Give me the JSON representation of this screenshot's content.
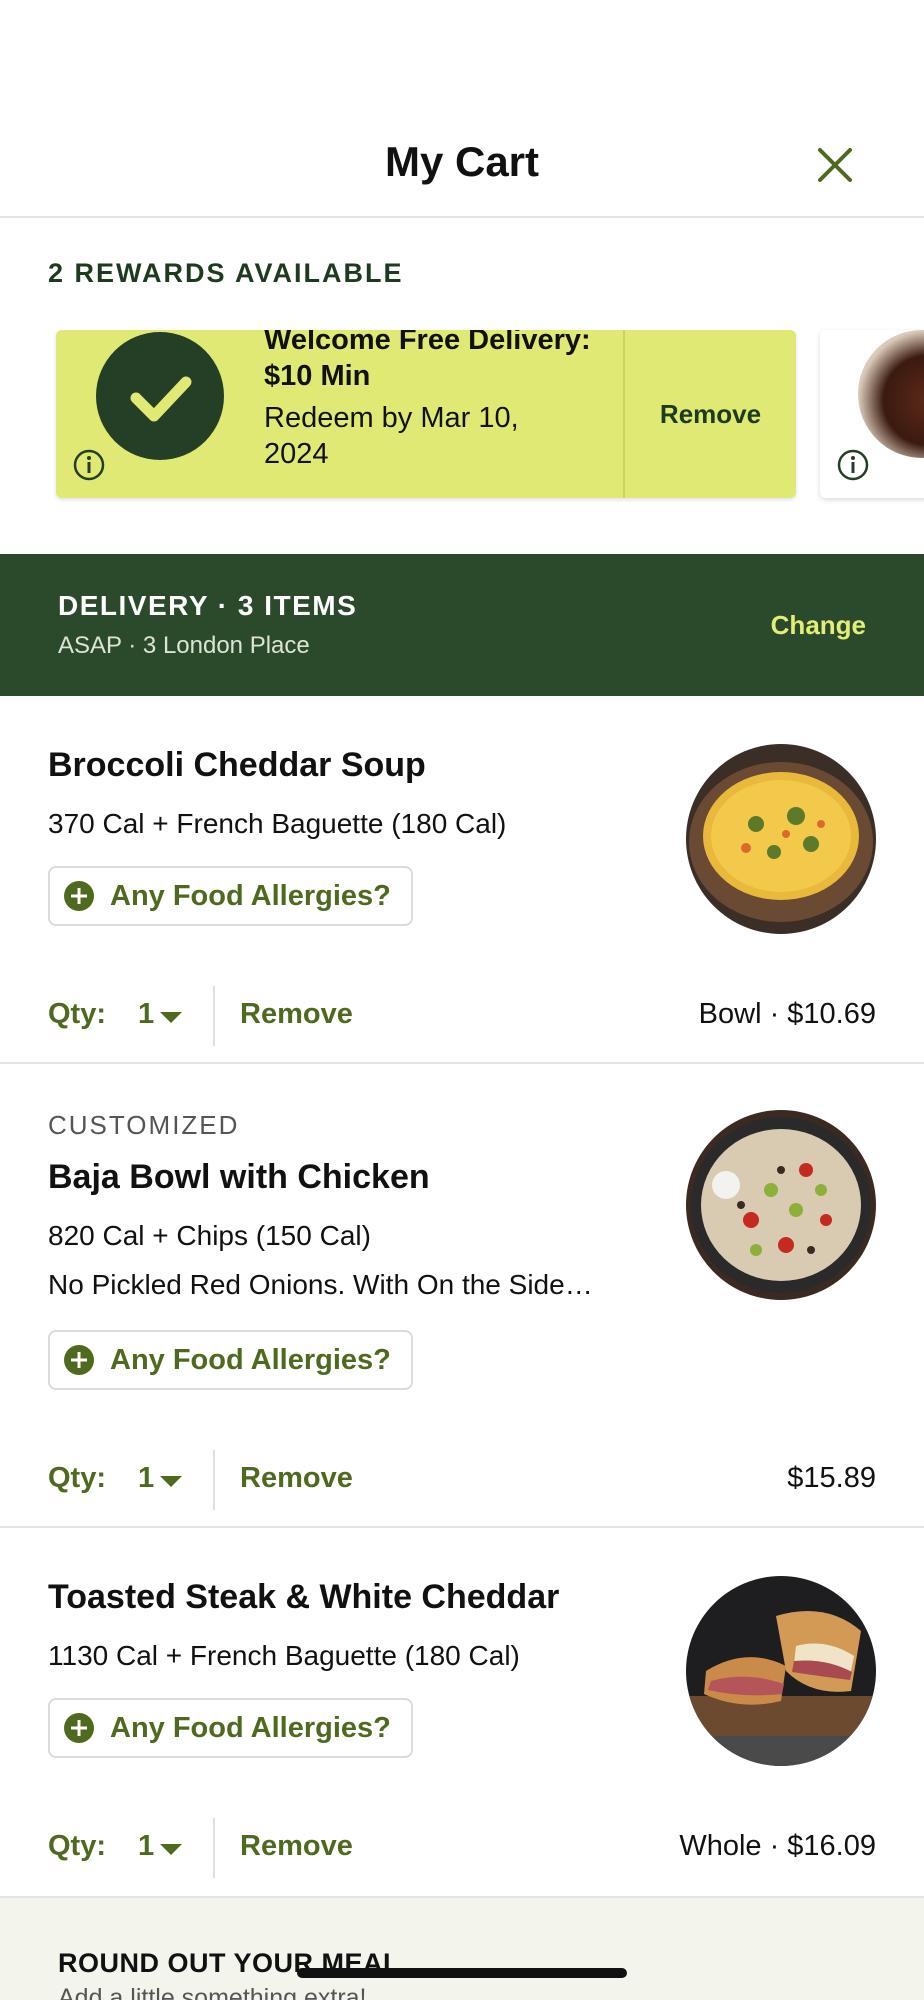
{
  "header": {
    "title": "My Cart"
  },
  "rewards": {
    "title": "2 REWARDS AVAILABLE",
    "cards": [
      {
        "name": "Welcome Free Delivery: $10 Min",
        "redeem": "Redeem by Mar 10, 2024",
        "action": "Remove",
        "selected": true
      }
    ]
  },
  "delivery": {
    "title": "DELIVERY · 3 ITEMS",
    "subtitle": "ASAP · 3 London Place",
    "change": "Change"
  },
  "items": [
    {
      "name": "Broccoli Cheddar Soup",
      "calories": "370 Cal  +  French Baguette (180 Cal)",
      "allergy": "Any Food Allergies?",
      "qty_label": "Qty:",
      "qty": "1",
      "remove": "Remove",
      "price": "Bowl  ·  $10.69"
    },
    {
      "tag": "CUSTOMIZED",
      "name": "Baja Bowl with Chicken",
      "calories": "820 Cal  +  Chips (150 Cal)",
      "note": "No Pickled Red Onions. With On the Side…",
      "allergy": "Any Food Allergies?",
      "qty_label": "Qty:",
      "qty": "1",
      "remove": "Remove",
      "price": "$15.89"
    },
    {
      "name": "Toasted Steak & White Cheddar",
      "calories": "1130 Cal  +  French Baguette (180 Cal)",
      "allergy": "Any Food Allergies?",
      "qty_label": "Qty:",
      "qty": "1",
      "remove": "Remove",
      "price": "Whole  ·  $16.09"
    }
  ],
  "roundout": {
    "title": "ROUND OUT YOUR MEAL",
    "subtitle": "Add a little something extra!"
  },
  "colors": {
    "brand_green": "#2b4a2c",
    "accent_green": "#4f6a1f",
    "reward_yellow": "#dfe973",
    "change_yellow": "#e3ed79"
  },
  "icons": [
    "close-icon",
    "check-icon",
    "info-icon",
    "plus-icon",
    "chevron-down-icon"
  ]
}
